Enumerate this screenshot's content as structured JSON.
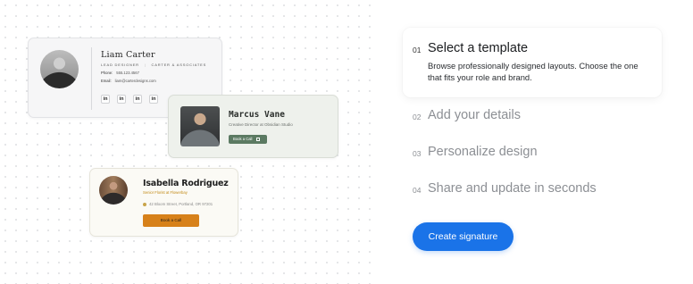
{
  "liam": {
    "name": "Liam Carter",
    "title": "LEAD DESIGNER",
    "company": "CARTER & ASSOCIATES",
    "phone_label": "Phone:",
    "phone": "555.123.4567",
    "email_label": "Email:",
    "email": "liam@carterdesigns.com",
    "socials": [
      "in",
      "in",
      "in",
      "in"
    ]
  },
  "marcus": {
    "name": "Marcus Vane",
    "title": "Creative Director at Obsidian Studio",
    "button": "Book a Call",
    "button_icon": "calendar-icon"
  },
  "isabella": {
    "name": "Isabella Rodriguez",
    "title": "Senior Florist at Flowerbay",
    "address": "42 Bloom Street, Portland, OR 97201",
    "button": "Book a Call"
  },
  "steps": [
    {
      "num": "01",
      "title": "Select a template",
      "desc": "Browse professionally designed layouts. Choose the one that fits your role and brand."
    },
    {
      "num": "02",
      "title": "Add your details"
    },
    {
      "num": "03",
      "title": "Personalize design"
    },
    {
      "num": "04",
      "title": "Share and update in seconds"
    }
  ],
  "cta": "Create signature",
  "colors": {
    "accent": "#1a73e8",
    "marcus_button": "#5b7a62",
    "isabella_button": "#d7811a",
    "isabella_title": "#c28a16"
  }
}
